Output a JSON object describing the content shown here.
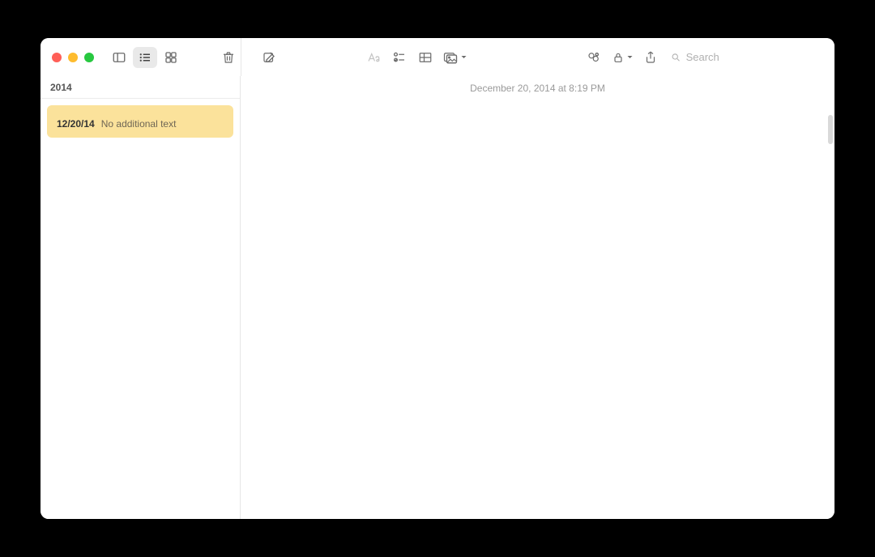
{
  "window": {
    "trafficLights": [
      "close",
      "minimize",
      "maximize"
    ]
  },
  "toolbar": {
    "search_placeholder": "Search"
  },
  "sidebar": {
    "section_header": "2014",
    "notes": [
      {
        "title_glyph": "",
        "date": "12/20/14",
        "snippet": "No additional text"
      }
    ]
  },
  "editor": {
    "datestamp": "December 20, 2014 at 8:19 PM",
    "content_glyph": ""
  }
}
